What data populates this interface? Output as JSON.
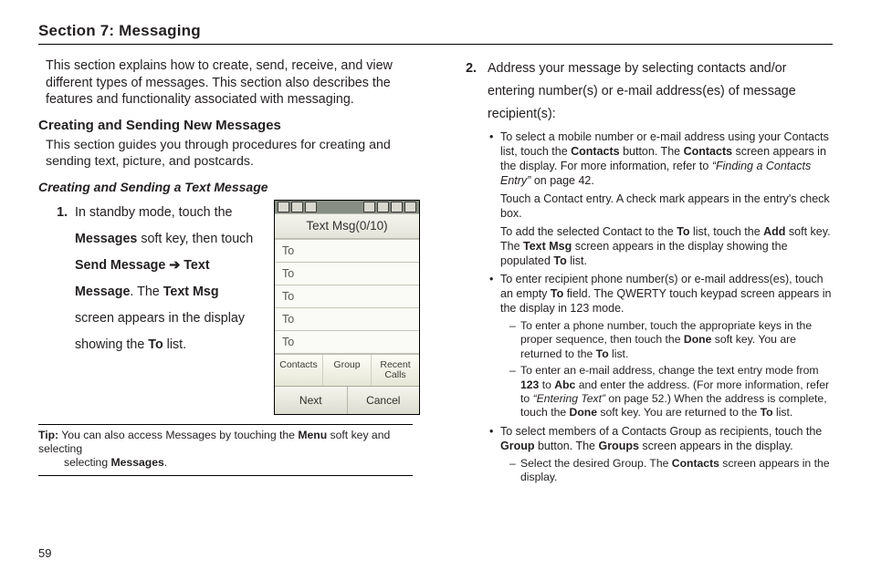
{
  "section_title": "Section 7: Messaging",
  "intro": "This section explains how to create, send, receive, and view different types of messages. This section also describes the features and functionality associated with messaging.",
  "h2": "Creating and Sending New Messages",
  "after_h2": "This section guides you through procedures for creating and sending text, picture, and postcards.",
  "h3": "Creating and Sending a Text Message",
  "step1_num": "1.",
  "step1_a": "In standby mode, touch the ",
  "step1_b": "Messages",
  "step1_c": " soft key, then touch ",
  "step1_d": "Send Message ➔ Text Message",
  "step1_e": ". The ",
  "step1_f": "Text Msg",
  "step1_g": " screen appears in the display showing the ",
  "step1_h": "To",
  "step1_i": " list.",
  "tip_label": "Tip:",
  "tip_a": " You can also access Messages by touching the ",
  "tip_b": "Menu",
  "tip_c": " soft key and selecting ",
  "tip_d": "Messages",
  "tip_e": ".",
  "phone": {
    "title": "Text Msg(0/10)",
    "rows": [
      "To",
      "To",
      "To",
      "To",
      "To"
    ],
    "btns": [
      "Contacts",
      "Group",
      "Recent\nCalls"
    ],
    "soft": [
      "Next",
      "Cancel"
    ]
  },
  "step2_num": "2.",
  "step2_text": "Address your message by selecting contacts and/or entering number(s) or e-mail address(es) of message recipient(s):",
  "b1_a": "To select a mobile number or e-mail address using your Contacts list, touch the ",
  "b1_b": "Contacts",
  "b1_c": " button. The ",
  "b1_d": "Contacts",
  "b1_e": " screen appears in the display. For more information, refer to ",
  "b1_f": "“Finding a Contacts Entry”",
  "b1_g": "  on page 42.",
  "b1_p2": "Touch a Contact entry. A check mark appears in the entry's check box.",
  "b1_p3a": "To add the selected Contact to the ",
  "b1_p3b": "To",
  "b1_p3c": " list, touch the ",
  "b1_p3d": "Add",
  "b1_p3e": " soft key. The ",
  "b1_p3f": "Text Msg",
  "b1_p3g": " screen appears in the display showing the populated ",
  "b1_p3h": "To",
  "b1_p3i": " list.",
  "b2_a": "To enter recipient phone number(s) or e-mail address(es), touch an empty ",
  "b2_b": "To",
  "b2_c": " field. The QWERTY touch keypad screen appears in the display in 123 mode.",
  "s1_a": "To enter a phone number, touch the appropriate keys in the proper sequence, then touch the ",
  "s1_b": "Done",
  "s1_c": " soft key. You are returned to the ",
  "s1_d": "To",
  "s1_e": " list.",
  "s2_a": "To enter an e-mail address, change the text entry mode from ",
  "s2_b": "123",
  "s2_c": " to ",
  "s2_d": "Abc",
  "s2_e": " and enter the address. (For more information, refer to ",
  "s2_f": "“Entering Text”",
  "s2_g": "  on page 52.) When the address is complete, touch the ",
  "s2_h": "Done",
  "s2_i": " soft key. You are returned to the ",
  "s2_j": "To",
  "s2_k": " list.",
  "b3_a": "To select members of a Contacts Group as recipients, touch the ",
  "b3_b": "Group",
  "b3_c": " button. The ",
  "b3_d": "Groups",
  "b3_e": " screen appears in the display.",
  "s3_a": "Select the desired Group. The ",
  "s3_b": "Contacts",
  "s3_c": " screen appears in the display.",
  "page_number": "59"
}
